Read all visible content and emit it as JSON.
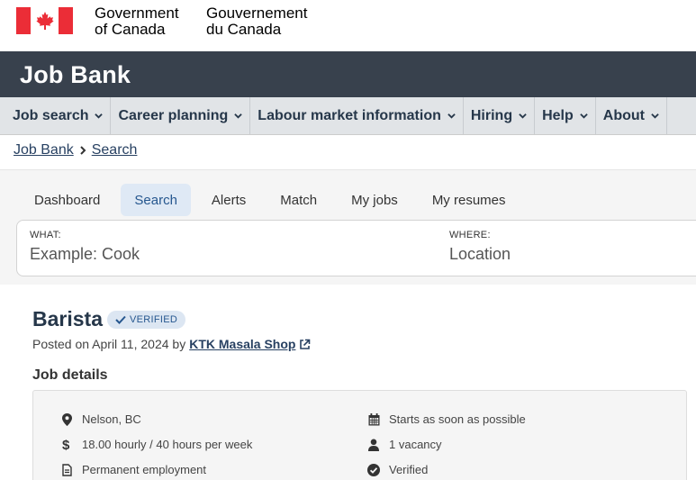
{
  "gov": {
    "en_line1": "Government",
    "en_line2": "of Canada",
    "fr_line1": "Gouvernement",
    "fr_line2": "du Canada"
  },
  "app": {
    "title": "Job Bank"
  },
  "nav": {
    "items": [
      {
        "label": "Job search"
      },
      {
        "label": "Career planning"
      },
      {
        "label": "Labour market information"
      },
      {
        "label": "Hiring"
      },
      {
        "label": "Help"
      },
      {
        "label": "About"
      }
    ]
  },
  "breadcrumb": {
    "home": "Job Bank",
    "current": "Search"
  },
  "tabs": [
    {
      "label": "Dashboard"
    },
    {
      "label": "Search",
      "active": true
    },
    {
      "label": "Alerts"
    },
    {
      "label": "Match"
    },
    {
      "label": "My jobs"
    },
    {
      "label": "My resumes"
    }
  ],
  "search": {
    "what_label": "WHAT:",
    "what_placeholder": "Example: Cook",
    "where_label": "WHERE:",
    "where_placeholder": "Location"
  },
  "job": {
    "title": "Barista",
    "badge": "VERIFIED",
    "posted_prefix": "Posted on April 11, 2024 by",
    "employer": "KTK Masala Shop",
    "details_heading": "Job details",
    "details": {
      "location": "Nelson, BC",
      "pay": "18.00 hourly / 40 hours per week",
      "employment": "Permanent employment",
      "start": "Starts as soon as possible",
      "vacancy": "1 vacancy",
      "verified": "Verified"
    }
  },
  "colors": {
    "flag_red": "#eb2d37",
    "app_bar": "#38414d",
    "nav_bg": "#e1e4e7",
    "link": "#284162",
    "tab_active_bg": "#dfe9f5"
  }
}
